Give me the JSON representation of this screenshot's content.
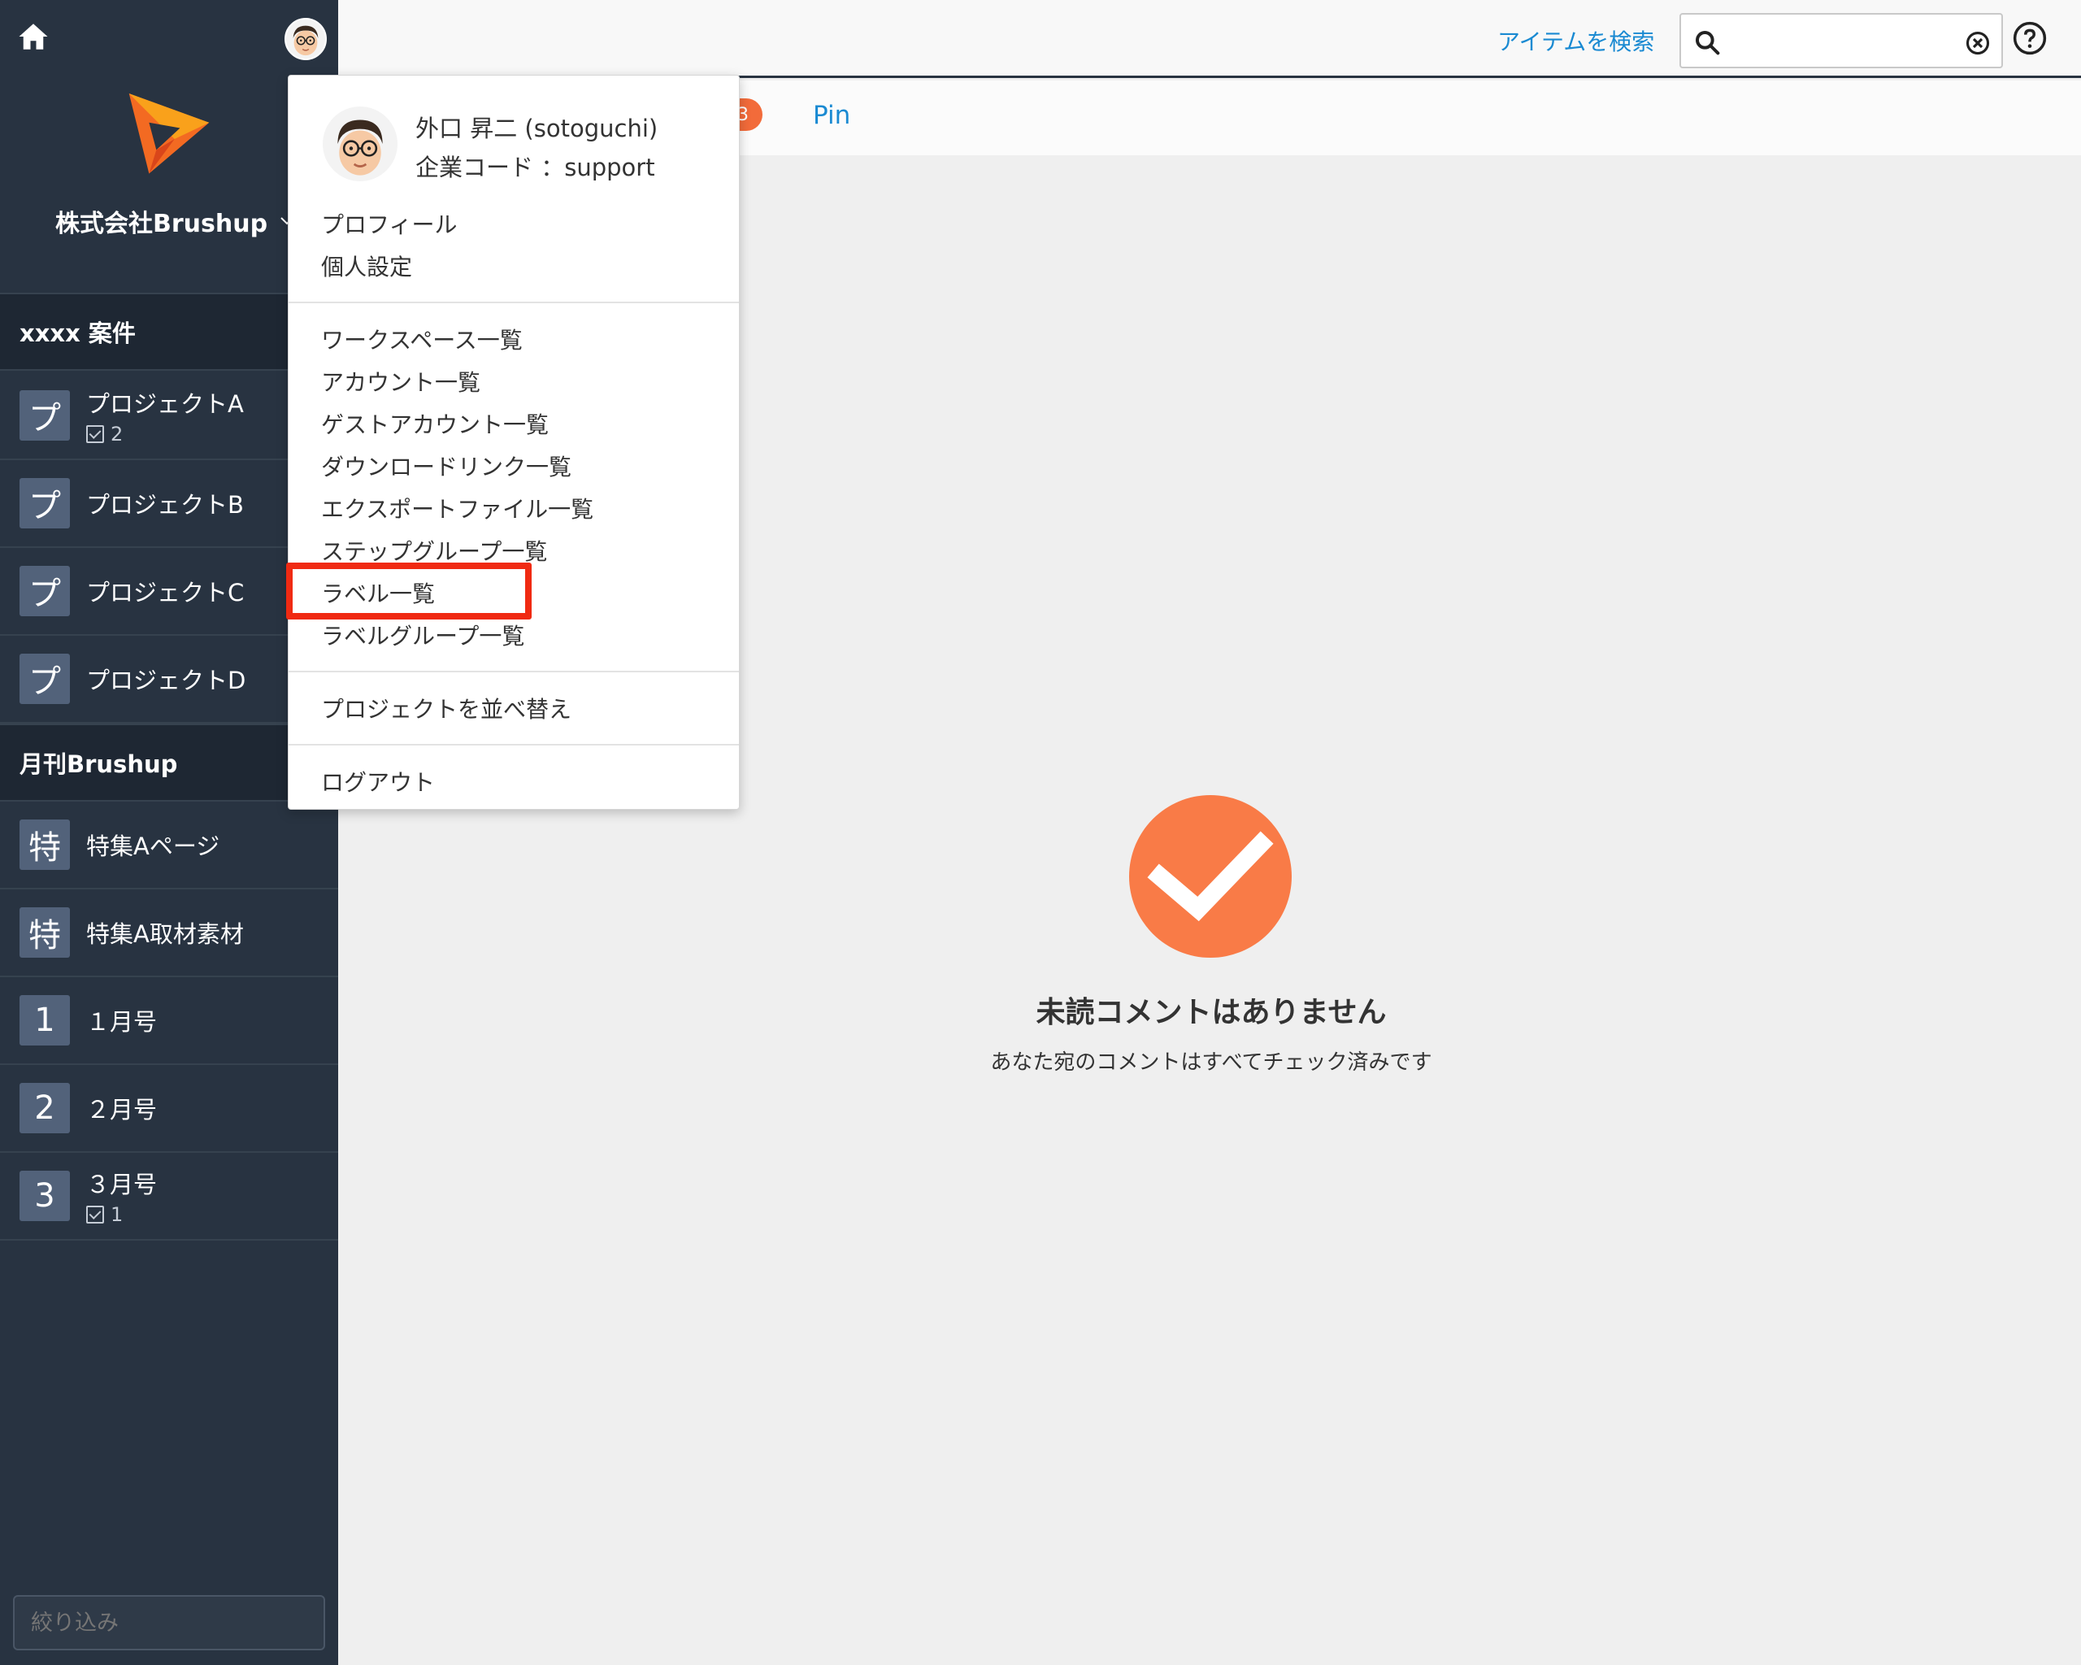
{
  "sidebar": {
    "company_name": "株式会社Brushup",
    "sections": [
      {
        "title": "xxxx 案件",
        "items": [
          {
            "badge": "プ",
            "label": "プロジェクトA",
            "count": "2"
          },
          {
            "badge": "プ",
            "label": "プロジェクトB"
          },
          {
            "badge": "プ",
            "label": "プロジェクトC"
          },
          {
            "badge": "プ",
            "label": "プロジェクトD"
          }
        ]
      },
      {
        "title": "月刊Brushup",
        "items": [
          {
            "badge": "特",
            "label": "特集Aページ"
          },
          {
            "badge": "特",
            "label": "特集A取材素材"
          },
          {
            "badge": "1",
            "label": "１月号"
          },
          {
            "badge": "2",
            "label": "２月号"
          },
          {
            "badge": "3",
            "label": "３月号",
            "count": "1"
          }
        ]
      }
    ],
    "filter_placeholder": "絞り込み"
  },
  "topbar": {
    "search_link": "アイテムを検索",
    "search_value": ""
  },
  "tabs": {
    "count_badge": "3",
    "pin_label": "Pin"
  },
  "empty_state": {
    "title": "未読コメントはありません",
    "subtitle": "あなた宛のコメントはすべてチェック済みです"
  },
  "user_menu": {
    "user_name": "外口 昇二 (sotoguchi)",
    "company_code": "企業コード ：support",
    "group1": [
      "プロフィール",
      "個人設定"
    ],
    "group2": [
      "ワークスペース一覧",
      "アカウント一覧",
      "ゲストアカウント一覧",
      "ダウンロードリンク一覧",
      "エクスポートファイル一覧",
      "ステップグループ一覧",
      "ラベル一覧",
      "ラベルグループ一覧"
    ],
    "group3": [
      "プロジェクトを並べ替え"
    ],
    "group4": [
      "ログアウト"
    ],
    "highlighted_item": "ラベル一覧"
  },
  "colors": {
    "sidebar_bg": "#283341",
    "accent_link": "#1a8ad2",
    "success_orange": "#f97b47",
    "highlight_red": "#f02a12"
  }
}
